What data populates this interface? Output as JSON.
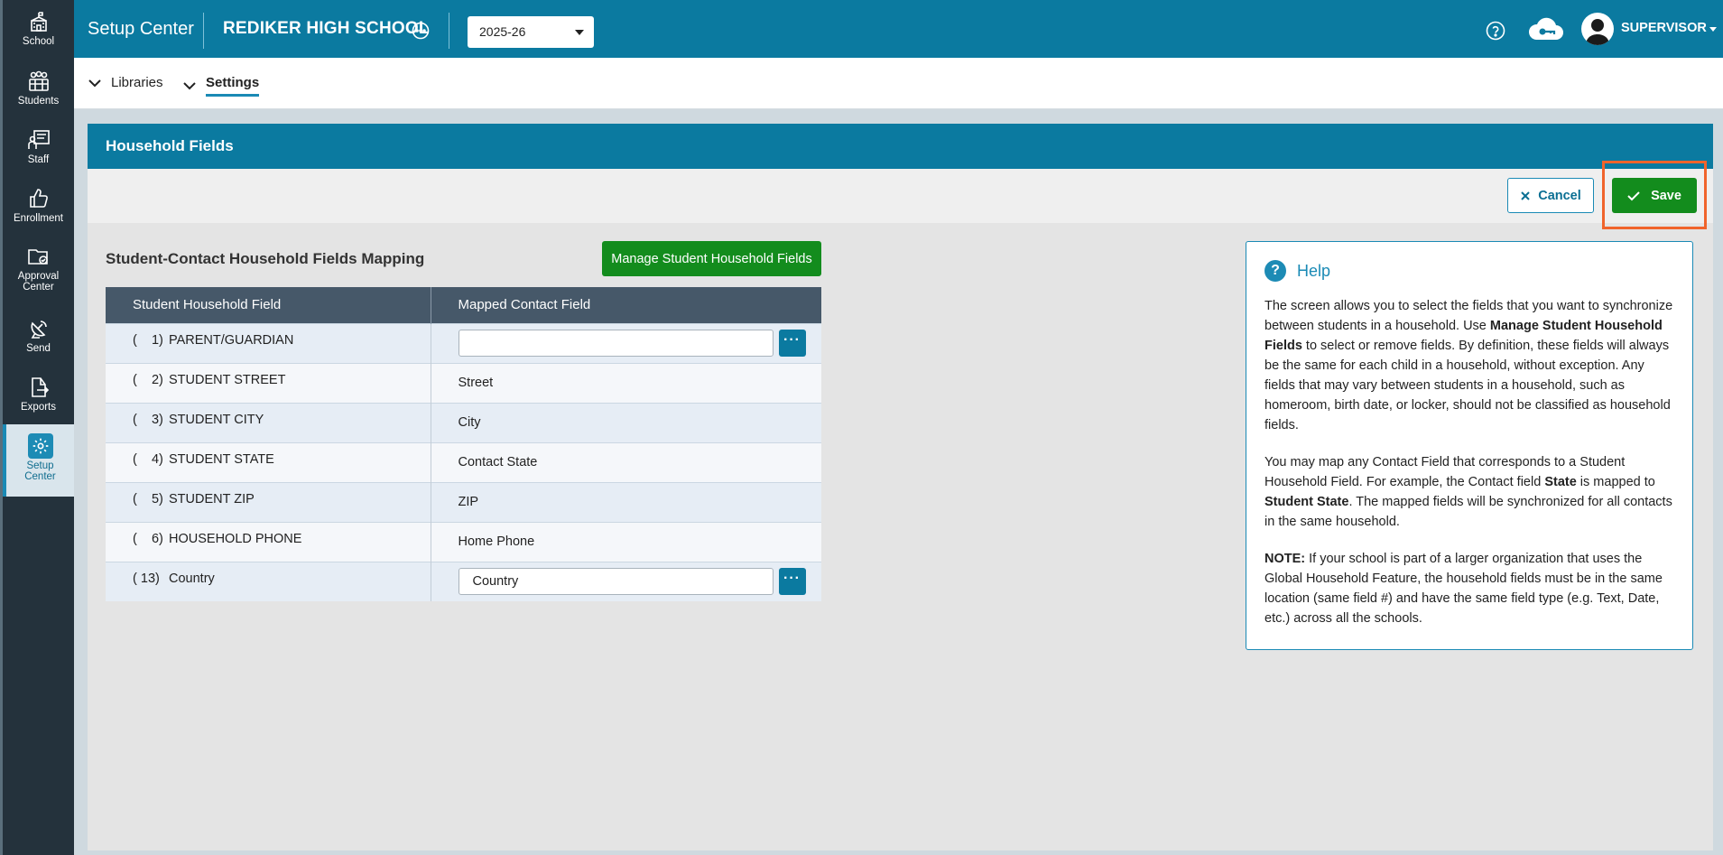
{
  "sidebar": {
    "items": [
      {
        "label": "School",
        "icon": "school-icon"
      },
      {
        "label": "Students",
        "icon": "students-icon"
      },
      {
        "label": "Staff",
        "icon": "staff-icon"
      },
      {
        "label": "Enrollment",
        "icon": "thumbs-up-icon"
      },
      {
        "label_line1": "Approval",
        "label_line2": "Center",
        "icon": "folder-approval-icon"
      },
      {
        "label": "Send",
        "icon": "satellite-dish-icon"
      },
      {
        "label": "Exports",
        "icon": "export-icon"
      },
      {
        "label_line1": "Setup",
        "label_line2": "Center",
        "icon": "gear-icon",
        "active": true
      }
    ]
  },
  "header": {
    "app_title": "Setup Center",
    "school_name": "REDIKER HIGH SCHOOL",
    "school_year": "2025-26",
    "user": "SUPERVISOR"
  },
  "subnav": {
    "items": [
      {
        "label": "Libraries"
      },
      {
        "label": "Settings",
        "active": true
      }
    ]
  },
  "panel": {
    "title": "Household Fields",
    "cancel_label": "Cancel",
    "save_label": "Save"
  },
  "mapping": {
    "title": "Student-Contact Household Fields Mapping",
    "manage_button": "Manage Student Household Fields",
    "col_student": "Student Household Field",
    "col_contact": "Mapped Contact Field",
    "rows": [
      {
        "paren": "(",
        "num": "1)",
        "field": "PARENT/GUARDIAN",
        "contact": "",
        "editable": true
      },
      {
        "paren": "(",
        "num": "2)",
        "field": "STUDENT STREET",
        "contact": "Street"
      },
      {
        "paren": "(",
        "num": "3)",
        "field": "STUDENT CITY",
        "contact": "City"
      },
      {
        "paren": "(",
        "num": "4)",
        "field": "STUDENT STATE",
        "contact": "Contact State"
      },
      {
        "paren": "(",
        "num": "5)",
        "field": "STUDENT ZIP",
        "contact": "ZIP"
      },
      {
        "paren": "(",
        "num": "6)",
        "field": "HOUSEHOLD PHONE",
        "contact": "Home Phone"
      },
      {
        "paren": "(",
        "num": "13)",
        "field": "Country",
        "contact": "Country",
        "editable": true
      }
    ]
  },
  "help": {
    "title": "Help",
    "p1_a": "The screen allows you to select the fields that you want to synchronize between students in a household. Use ",
    "p1_b": "Manage Student Household Fields",
    "p1_c": " to select or remove fields. By definition, these fields will always be the same for each child in a household, without exception. Any fields that may vary between students in a household, such as homeroom, birth date, or locker, should not be classified as household fields.",
    "p2_a": "You may map any Contact Field that corresponds to a Student Household Field. For example, the Contact field ",
    "p2_b": "State",
    "p2_c": " is mapped to ",
    "p2_d": "Student State",
    "p2_e": ". The mapped fields will be synchronized for all contacts in the same household.",
    "p3_a": "NOTE:",
    "p3_b": " If your school is part of a larger organization that uses the Global Household Feature, the household fields must be in the same location (same field #) and have the same field type (e.g. Text, Date, etc.) across all the schools."
  },
  "colors": {
    "brand": "#0b7aa0",
    "sidebar": "#24323c",
    "save_green": "#138c1d",
    "highlight": "#f0642c"
  }
}
